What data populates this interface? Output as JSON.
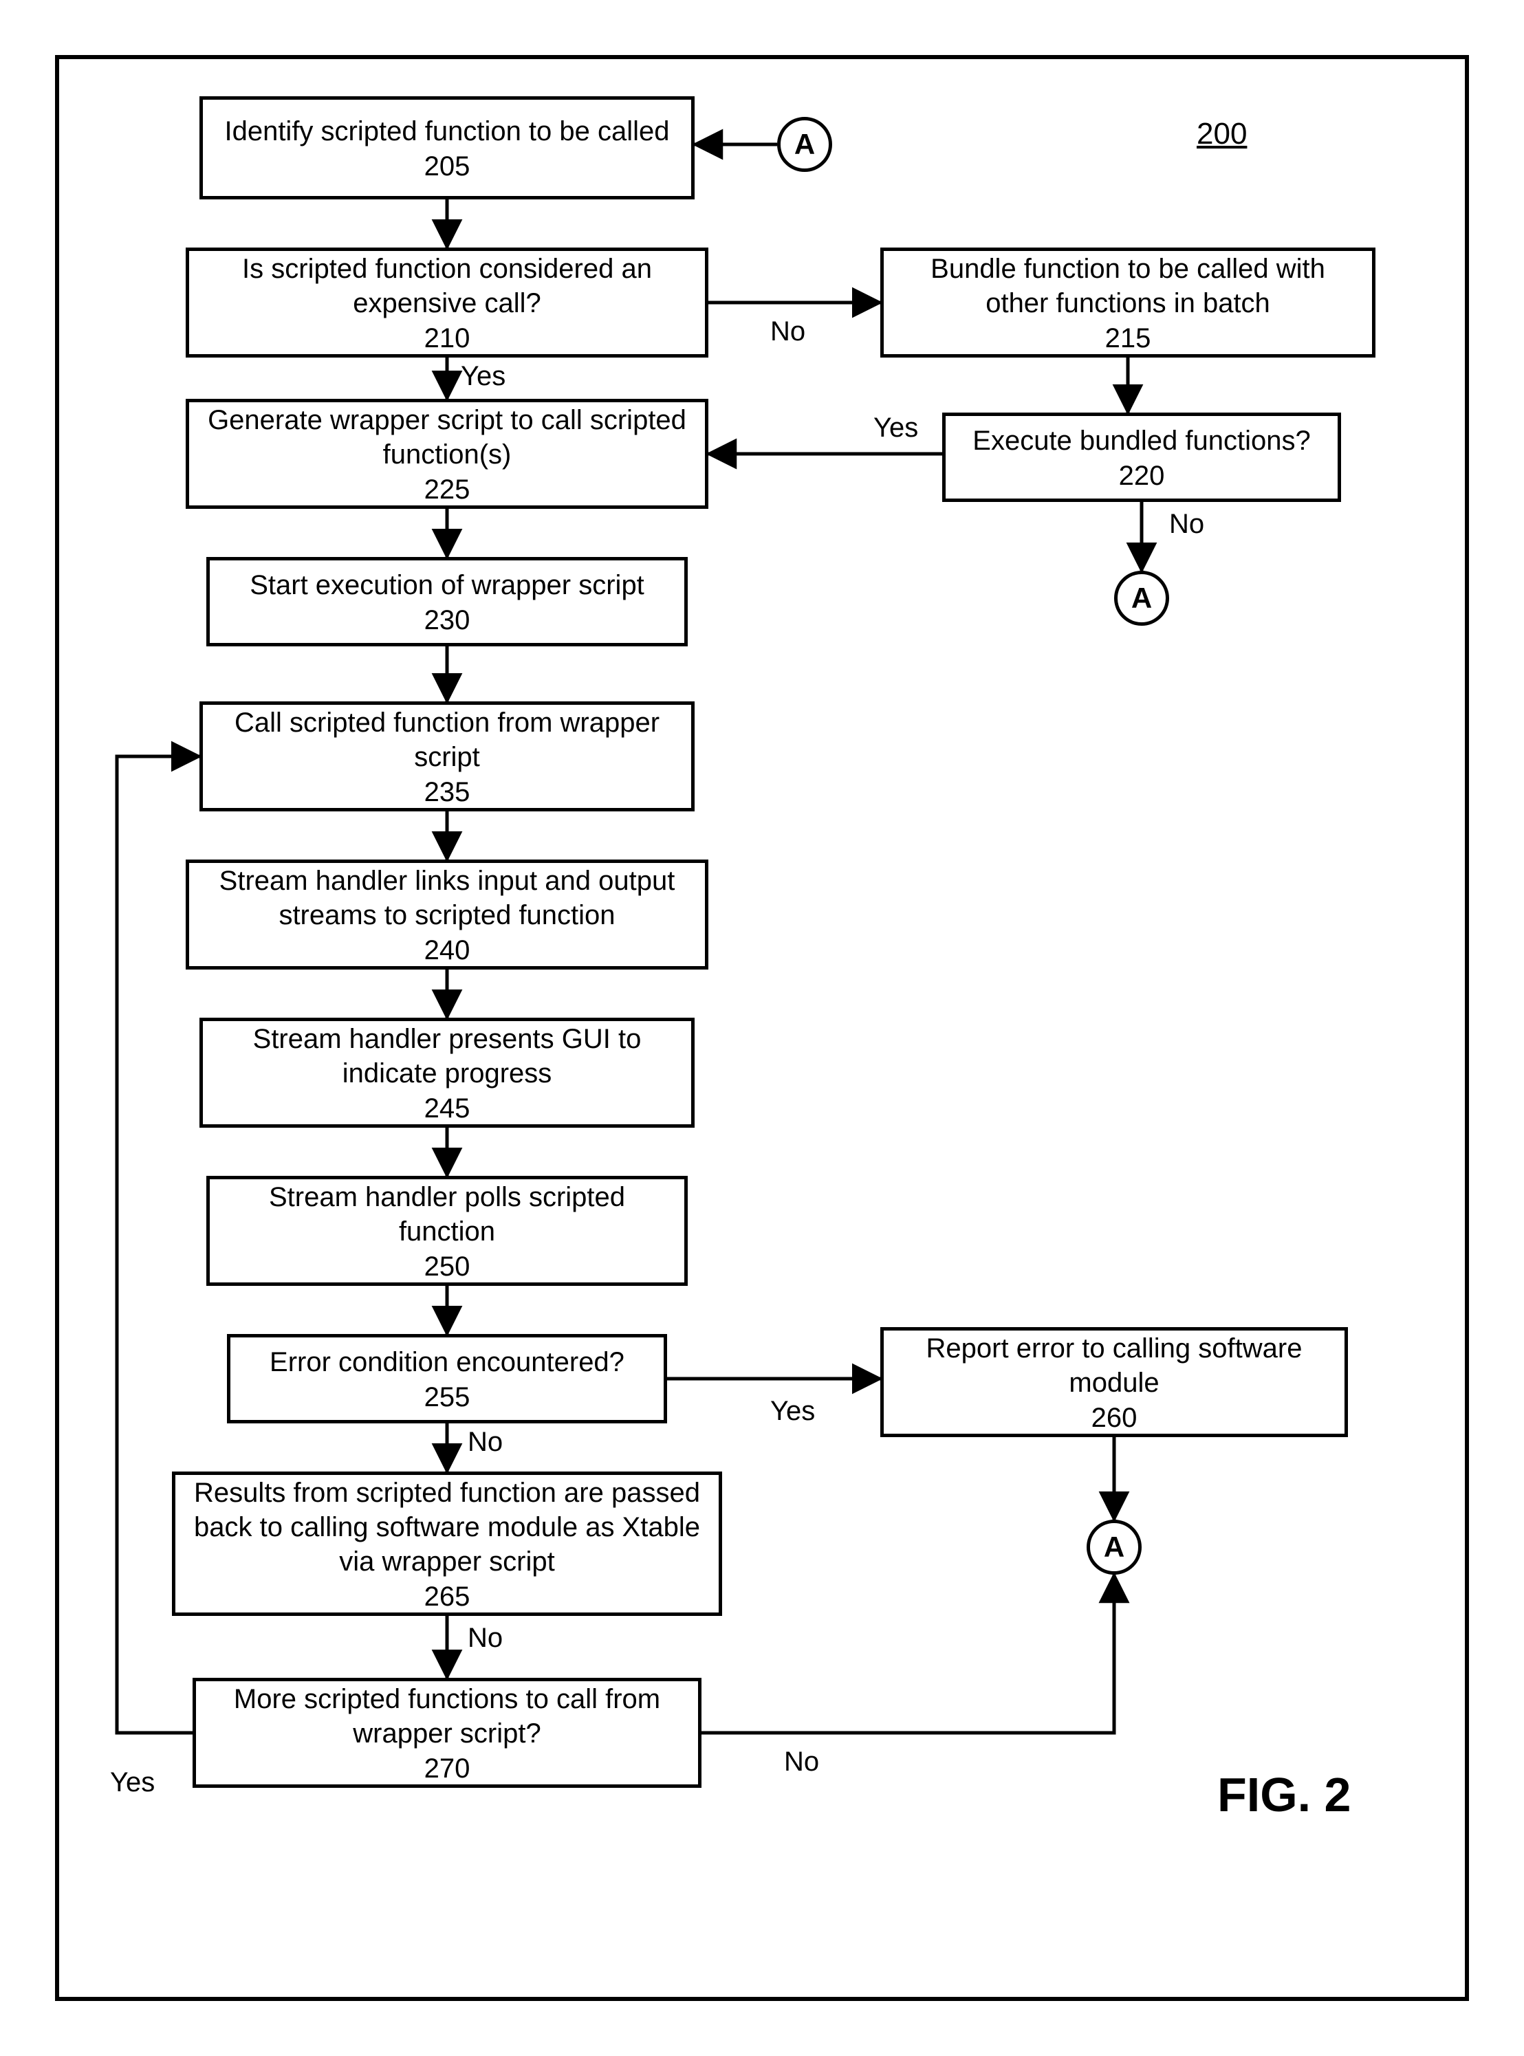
{
  "page_number": "200",
  "figure_label": "FIG. 2",
  "connector_label": "A",
  "edge_labels": {
    "yes": "Yes",
    "no": "No"
  },
  "nodes": {
    "n205": {
      "text": "Identify scripted function to be called",
      "num": "205"
    },
    "n210": {
      "text": "Is scripted function considered an expensive call?",
      "num": "210"
    },
    "n215": {
      "text": "Bundle function to be called with other functions in batch",
      "num": "215"
    },
    "n220": {
      "text": "Execute bundled functions?",
      "num": "220"
    },
    "n225": {
      "text": "Generate wrapper script to call scripted function(s)",
      "num": "225"
    },
    "n230": {
      "text": "Start execution of wrapper script",
      "num": "230"
    },
    "n235": {
      "text": "Call scripted function from wrapper script",
      "num": "235"
    },
    "n240": {
      "text": "Stream handler links input and output streams to scripted function",
      "num": "240"
    },
    "n245": {
      "text": "Stream handler presents GUI to indicate progress",
      "num": "245"
    },
    "n250": {
      "text": "Stream handler polls scripted function",
      "num": "250"
    },
    "n255": {
      "text": "Error condition encountered?",
      "num": "255"
    },
    "n260": {
      "text": "Report error to calling software module",
      "num": "260"
    },
    "n265": {
      "text": "Results from scripted function are passed back to calling software module as Xtable via wrapper script",
      "num": "265"
    },
    "n270": {
      "text": "More scripted functions to call from wrapper script?",
      "num": "270"
    }
  }
}
